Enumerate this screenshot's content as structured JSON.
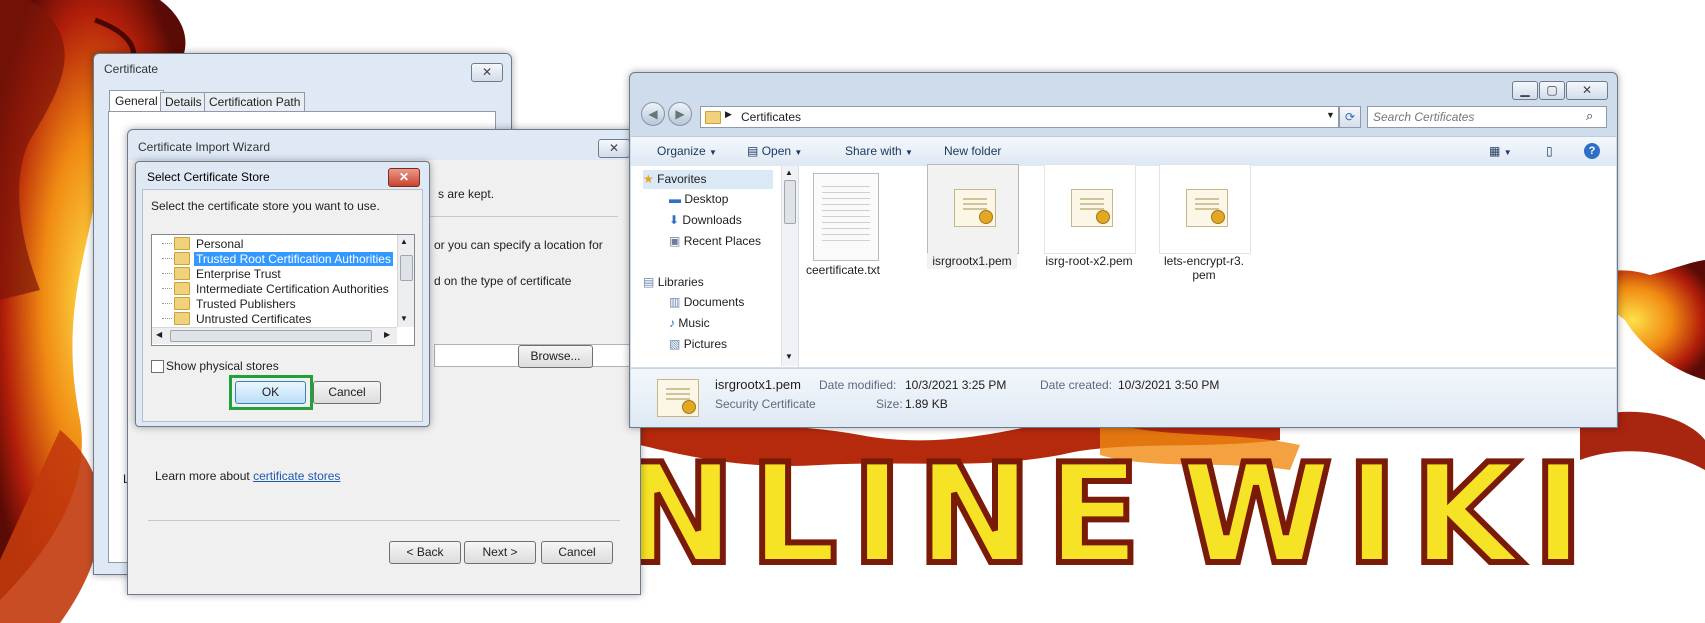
{
  "certificate_window": {
    "title": "Certificate",
    "close_label": "✕",
    "tabs": [
      "General",
      "Details",
      "Certification Path"
    ]
  },
  "import_wizard": {
    "title": "Certificate Import Wizard",
    "close_label": "✕",
    "body_fragments": [
      "s are kept.",
      "or you can specify a location for",
      "d on the type of certificate"
    ],
    "browse_label": "Browse...",
    "learn_more_prefix": "Learn more about ",
    "learn_more_link": "certificate stores",
    "behind_fragment": "Le",
    "back_label": "< Back",
    "next_label": "Next >",
    "cancel_label": "Cancel"
  },
  "select_store": {
    "title": "Select Certificate Store",
    "close_label": "✕",
    "instruction": "Select the certificate store you want to use.",
    "stores": [
      "Personal",
      "Trusted Root Certification Authorities",
      "Enterprise Trust",
      "Intermediate Certification Authorities",
      "Trusted Publishers",
      "Untrusted Certificates"
    ],
    "selected_index": 1,
    "show_physical_label": "Show physical stores",
    "ok_label": "OK",
    "cancel_label": "Cancel",
    "highlight_color": "#22a03a"
  },
  "explorer": {
    "breadcrumb": "Certificates",
    "search_placeholder": "Search Certificates",
    "toolbar": {
      "organize": "Organize",
      "open": "Open",
      "share_with": "Share with",
      "new_folder": "New folder"
    },
    "sidebar": {
      "favorites_header": "Favorites",
      "favorites": [
        "Desktop",
        "Downloads",
        "Recent Places"
      ],
      "libraries_header": "Libraries",
      "libraries": [
        "Documents",
        "Music",
        "Pictures"
      ]
    },
    "files": [
      {
        "name": "ceertificate.txt",
        "type": "text"
      },
      {
        "name": "isrgrootx1.pem",
        "type": "cert"
      },
      {
        "name": "isrg-root-x2.pem",
        "type": "cert"
      },
      {
        "name": "lets-encrypt-r3.pem",
        "type": "cert"
      }
    ],
    "details": {
      "name": "isrgrootx1.pem",
      "type": "Security Certificate",
      "modified_label": "Date modified:",
      "modified_value": "10/3/2021 3:25 PM",
      "created_label": "Date created:",
      "created_value": "10/3/2021 3:50 PM",
      "size_label": "Size:",
      "size_value": "1.89 KB"
    }
  },
  "background": {
    "word_left": "NLINE",
    "word_right": "WIKI"
  }
}
